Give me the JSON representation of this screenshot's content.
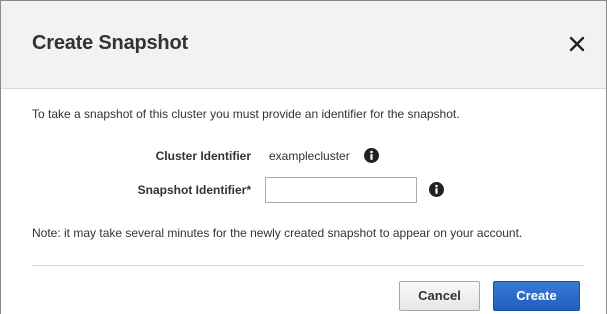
{
  "dialog": {
    "title": "Create Snapshot",
    "close_icon": "close-icon",
    "intro_text": "To take a snapshot of this cluster you must provide an identifier for the snapshot.",
    "cluster": {
      "label": "Cluster Identifier",
      "value": "examplecluster",
      "icon": "info-icon"
    },
    "snapshot": {
      "label": "Snapshot Identifier*",
      "value": "",
      "placeholder": "",
      "icon": "info-icon"
    },
    "note_text": "Note: it may take several minutes for the newly created snapshot to appear on your account.",
    "buttons": {
      "cancel_label": "Cancel",
      "create_label": "Create"
    }
  },
  "colors": {
    "header_bg": "#f2f2f2",
    "primary": "#2a6ecf",
    "text": "#333333"
  }
}
